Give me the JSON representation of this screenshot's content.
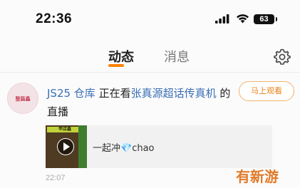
{
  "status_bar": {
    "time": "22:36",
    "battery": "63",
    "icons": [
      "signal-icon",
      "wifi-icon",
      "battery-icon"
    ]
  },
  "tabs": [
    {
      "label": "动态",
      "active": true
    },
    {
      "label": "消息",
      "active": false
    }
  ],
  "header": {
    "settings_icon": "gear-icon",
    "accent_color": "#ff8200"
  },
  "post": {
    "avatar_text": "整篇鑫",
    "user_name": "JS25 仓库",
    "verb": " 正在看",
    "target_link": "张真源超话传真机",
    "suffix": " 的直播",
    "watch_button": "马上观看",
    "live_card": {
      "thumbnail_title": "甲店鑫",
      "text": "一起冲",
      "gem": "💎",
      "text_after": "chao"
    },
    "timestamp": "22:07"
  },
  "watermark": "有新游",
  "colors": {
    "link": "#3a6fb5",
    "button_border": "#f2b36b",
    "button_text": "#e8811a"
  }
}
